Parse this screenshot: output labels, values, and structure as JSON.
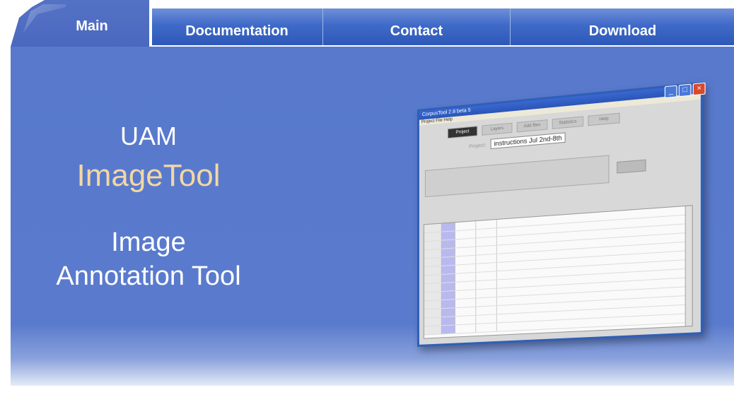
{
  "nav": {
    "tabs": [
      {
        "label": "Main"
      },
      {
        "label": "Documentation"
      },
      {
        "label": "Contact"
      },
      {
        "label": "Download"
      }
    ]
  },
  "hero": {
    "line1": "UAM",
    "line2": "ImageTool",
    "line3": "Image",
    "line4": "Annotation Tool"
  },
  "screenshot": {
    "window_title": "CorpusTool 2.8 beta 5",
    "menu": "Project  File  Help",
    "tabs": [
      "Project",
      "Layers",
      "Add files",
      "Statistics",
      "Help"
    ],
    "project_label": "Project:",
    "project_name": "instructions Jul 2nd-8th"
  },
  "colors": {
    "accent": "#3f6ac8",
    "panel": "#5879cc",
    "title_highlight": "#f3d7a4"
  }
}
